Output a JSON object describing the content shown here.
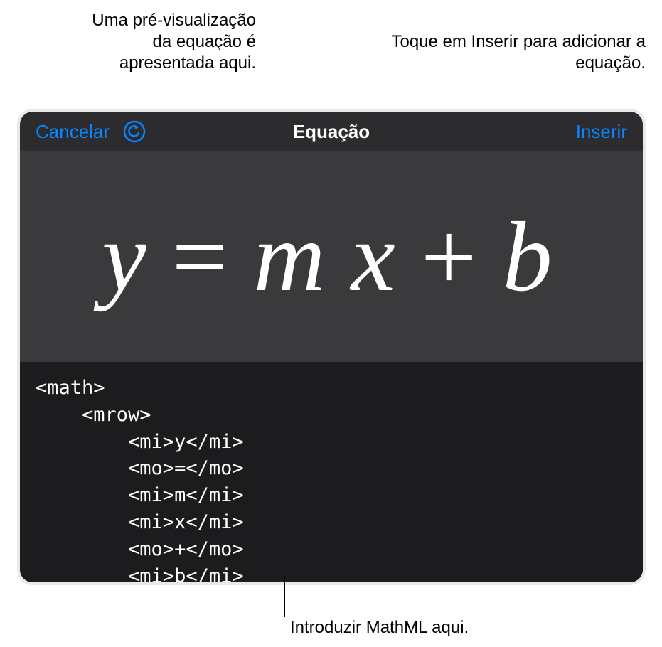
{
  "callouts": {
    "preview": "Uma pré-visualização\nda equação é\napresentada aqui.",
    "insert": "Toque em Inserir para\nadicionar a equação.",
    "input": "Introduzir MathML aqui."
  },
  "header": {
    "cancel": "Cancelar",
    "title": "Equação",
    "insert": "Inserir"
  },
  "equation": {
    "y": "y",
    "eq": "=",
    "m": "m",
    "x": "x",
    "plus": "+",
    "b": "b"
  },
  "code": "<math>\n    <mrow>\n        <mi>y</mi>\n        <mo>=</mo>\n        <mi>m</mi>\n        <mi>x</mi>\n        <mo>+</mo>\n        <mi>b</mi>"
}
